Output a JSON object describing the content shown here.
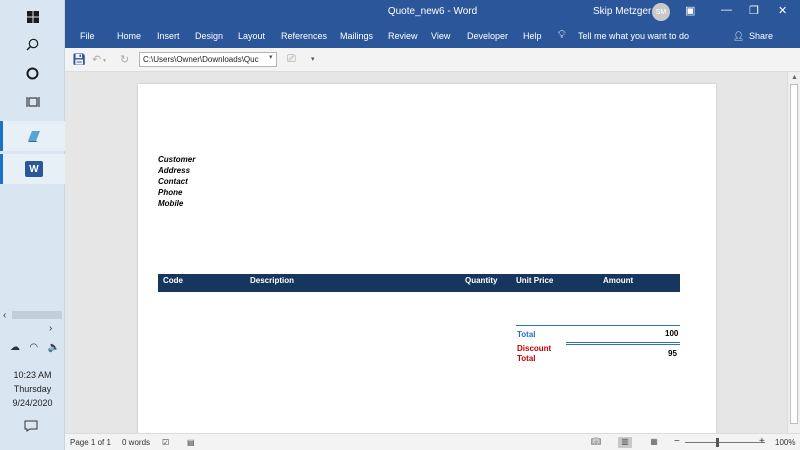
{
  "taskbar": {
    "icons": [
      "windows-icon",
      "search-icon",
      "cortana-icon",
      "task-view-icon",
      "pinned-app-icon",
      "word-icon"
    ],
    "clock": {
      "time": "10:23 AM",
      "day": "Thursday",
      "date": "9/24/2020"
    }
  },
  "window": {
    "title": "Quote_new6 - Word",
    "user_name": "Skip Metzger",
    "user_initials": "SM"
  },
  "ribbon": {
    "tabs": [
      "File",
      "Home",
      "Insert",
      "Design",
      "Layout",
      "References",
      "Mailings",
      "Review",
      "View",
      "Developer",
      "Help"
    ],
    "tell_me": "Tell me what you want to do",
    "share": "Share"
  },
  "qat": {
    "path": "C:\\Users\\Owner\\Downloads\\Quc"
  },
  "document": {
    "fields": [
      "Customer",
      "Address",
      "Contact",
      "Phone",
      "Mobile"
    ],
    "table_headers": [
      "Code",
      "Description",
      "Quantity",
      "Unit Price",
      "Amount"
    ],
    "total_label": "Total",
    "total_value": "100",
    "discount_label_line1": "Discount",
    "discount_label_line2": "Total",
    "discount_value": "95"
  },
  "status": {
    "page": "Page 1 of 1",
    "words": "0 words",
    "zoom_minus": "−",
    "zoom_plus": "+",
    "zoom": "100%"
  },
  "colors": {
    "word_blue": "#2b579a",
    "table_header": "#17365d",
    "total_blue": "#1f70c1",
    "discount_red": "#c00000"
  }
}
